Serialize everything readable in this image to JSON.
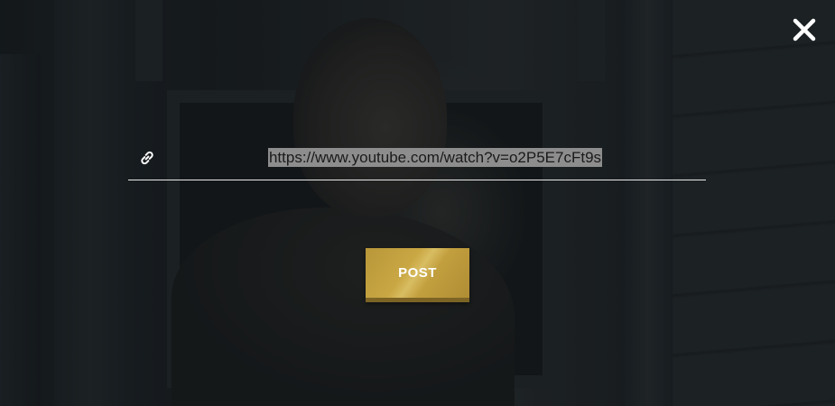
{
  "modal": {
    "url_value": "https://www.youtube.com/watch?v=o2P5E7cFt9s",
    "post_label": "POST",
    "close_icon": "close-icon",
    "link_icon": "link-icon"
  },
  "colors": {
    "accent_gold": "#c9a743",
    "underline": "#e9e9e9",
    "text": "#f2f2f2",
    "selection": "#8d8d8d"
  }
}
